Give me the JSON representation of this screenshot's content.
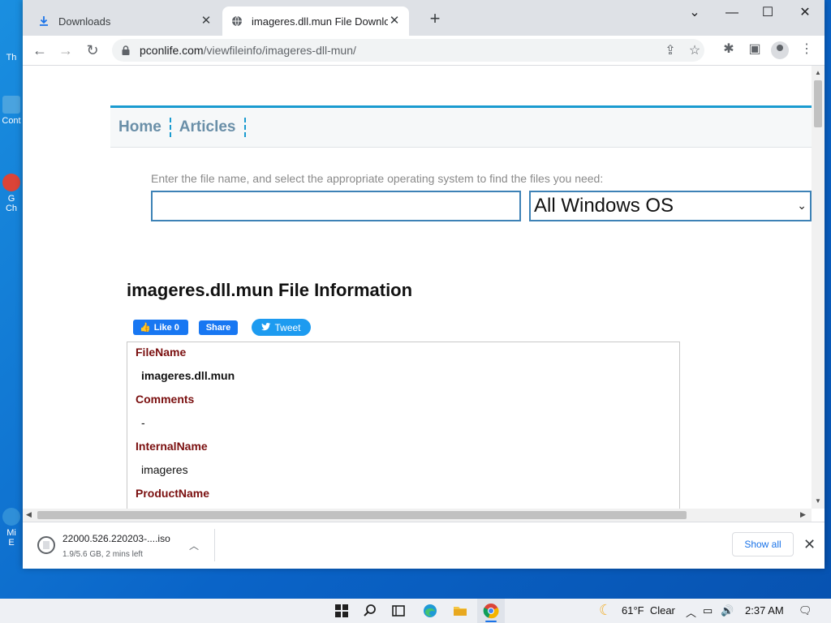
{
  "desktop": {
    "icons": [
      {
        "label": "Th"
      },
      {
        "label": "Cont"
      },
      {
        "label": "G\nCh"
      },
      {
        "label": "Mi\nE"
      }
    ]
  },
  "browser": {
    "tabs": [
      {
        "title": "Downloads",
        "icon": "download-icon",
        "active": false
      },
      {
        "title": "imageres.dll.mun File Download",
        "icon": "globe-icon",
        "active": true
      }
    ],
    "new_tab_label": "+",
    "window_controls": {
      "dropdown": "⌄",
      "minimize": "—",
      "maximize": "☐",
      "close": "✕"
    },
    "address": {
      "host": "pconlife.com",
      "path": "/viewfileinfo/imageres-dll-mun/"
    }
  },
  "site": {
    "nav": [
      {
        "label": "Home"
      },
      {
        "label": "Articles"
      }
    ],
    "search_hint": "Enter the file name, and select the appropriate operating system to find the files you need:",
    "search_value": "",
    "os_select": "All Windows OS",
    "file_title": "imageres.dll.mun File Information",
    "social": {
      "like": "Like 0",
      "share": "Share",
      "tweet": "Tweet"
    },
    "info": [
      {
        "key": "FileName",
        "value": "imageres.dll.mun",
        "bold": true
      },
      {
        "key": "Comments",
        "value": "-",
        "bold": false
      },
      {
        "key": "InternalName",
        "value": "imageres",
        "bold": false
      },
      {
        "key": "ProductName",
        "value": "",
        "bold": false
      }
    ]
  },
  "download_shelf": {
    "file_name": "22000.526.220203-....iso",
    "status": "1.9/5.6 GB, 2 mins left",
    "show_all": "Show all"
  },
  "taskbar": {
    "weather": "61°F  Clear",
    "time": "2:37 AM"
  },
  "colors": {
    "accent_blue": "#1a9bd0",
    "info_key": "#7a0f0f",
    "facebook": "#1877f2",
    "twitter": "#1d9bf0"
  }
}
